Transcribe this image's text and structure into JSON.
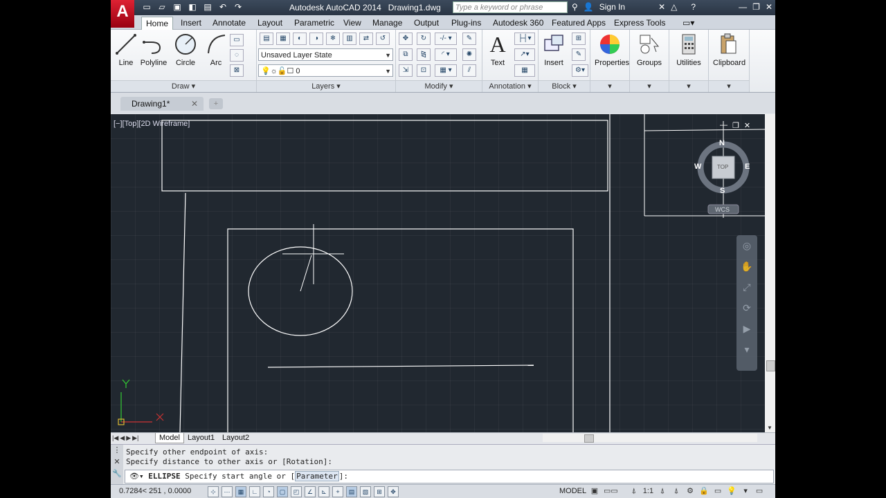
{
  "titlebar": {
    "app_title": "Autodesk AutoCAD 2014",
    "file_name": "Drawing1.dwg",
    "search_placeholder": "Type a keyword or phrase",
    "sign_in": "Sign In",
    "help": "?"
  },
  "ribbon_tabs": [
    "Home",
    "Insert",
    "Annotate",
    "Layout",
    "Parametric",
    "View",
    "Manage",
    "Output",
    "Plug-ins",
    "Autodesk 360",
    "Featured Apps",
    "Express Tools"
  ],
  "ribbon": {
    "draw": {
      "title": "Draw",
      "tools": [
        "Line",
        "Polyline",
        "Circle",
        "Arc"
      ]
    },
    "layers": {
      "title": "Layers",
      "layer_state": "Unsaved Layer State",
      "current_layer": "0"
    },
    "modify": {
      "title": "Modify"
    },
    "annotation": {
      "title": "Annotation",
      "text_label": "Text"
    },
    "block": {
      "title": "Block",
      "insert_label": "Insert"
    },
    "properties": "Properties",
    "groups": "Groups",
    "utilities": "Utilities",
    "clipboard": "Clipboard"
  },
  "doc_tab": {
    "name": "Drawing1*"
  },
  "viewport": {
    "label": "[−][Top][2D Wireframe]"
  },
  "viewcube": {
    "north": "N",
    "south": "S",
    "east": "E",
    "west": "W",
    "top": "TOP",
    "wcs": "WCS"
  },
  "ucs": {
    "x": "X",
    "y": "Y"
  },
  "layout_tabs": [
    "Model",
    "Layout1",
    "Layout2"
  ],
  "command": {
    "history": [
      "Specify other endpoint of axis:",
      "Specify distance to other axis or [Rotation]:"
    ],
    "current_cmd": "ELLIPSE",
    "prompt_before": "Specify start angle or [",
    "option": "Parameter",
    "prompt_after": "]:"
  },
  "status": {
    "coords": "0.7284< 251 , 0.0000",
    "model": "MODEL",
    "scale": "1:1"
  },
  "colors": {
    "canvas": "#212830",
    "accent": "#d22030",
    "linework": "#ffffff"
  }
}
